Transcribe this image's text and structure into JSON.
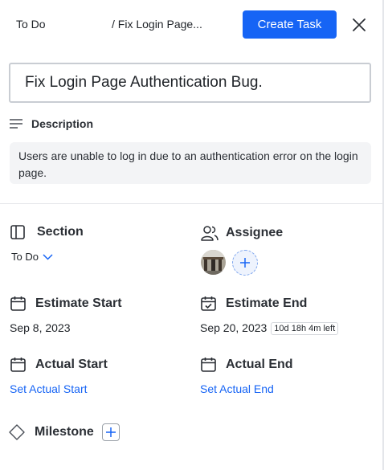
{
  "header": {
    "breadcrumb_root": "To Do",
    "breadcrumb_current": "/ Fix Login Page...",
    "create_button": "Create Task"
  },
  "task": {
    "title": "Fix Login Page Authentication Bug.",
    "description_label": "Description",
    "description_text": "Users are unable to log in due to an authentication error on the login page."
  },
  "fields": {
    "section_label": "Section",
    "section_value": "To Do",
    "assignee_label": "Assignee",
    "estimate_start_label": "Estimate Start",
    "estimate_start_value": "Sep 8, 2023",
    "estimate_end_label": "Estimate End",
    "estimate_end_value": "Sep 20, 2023",
    "time_left": "10d 18h 4m left",
    "actual_start_label": "Actual Start",
    "actual_start_link": "Set Actual Start",
    "actual_end_label": "Actual End",
    "actual_end_link": "Set Actual End",
    "milestone_label": "Milestone"
  },
  "colors": {
    "accent": "#1664f5",
    "description_bg": "#f3f4f6"
  },
  "icons": [
    "close-icon",
    "lines-icon",
    "sidebar-panel-icon",
    "chevron-down-icon",
    "users-icon",
    "calendar-icon",
    "calendar-check-icon",
    "diamond-icon",
    "plus-icon"
  ]
}
